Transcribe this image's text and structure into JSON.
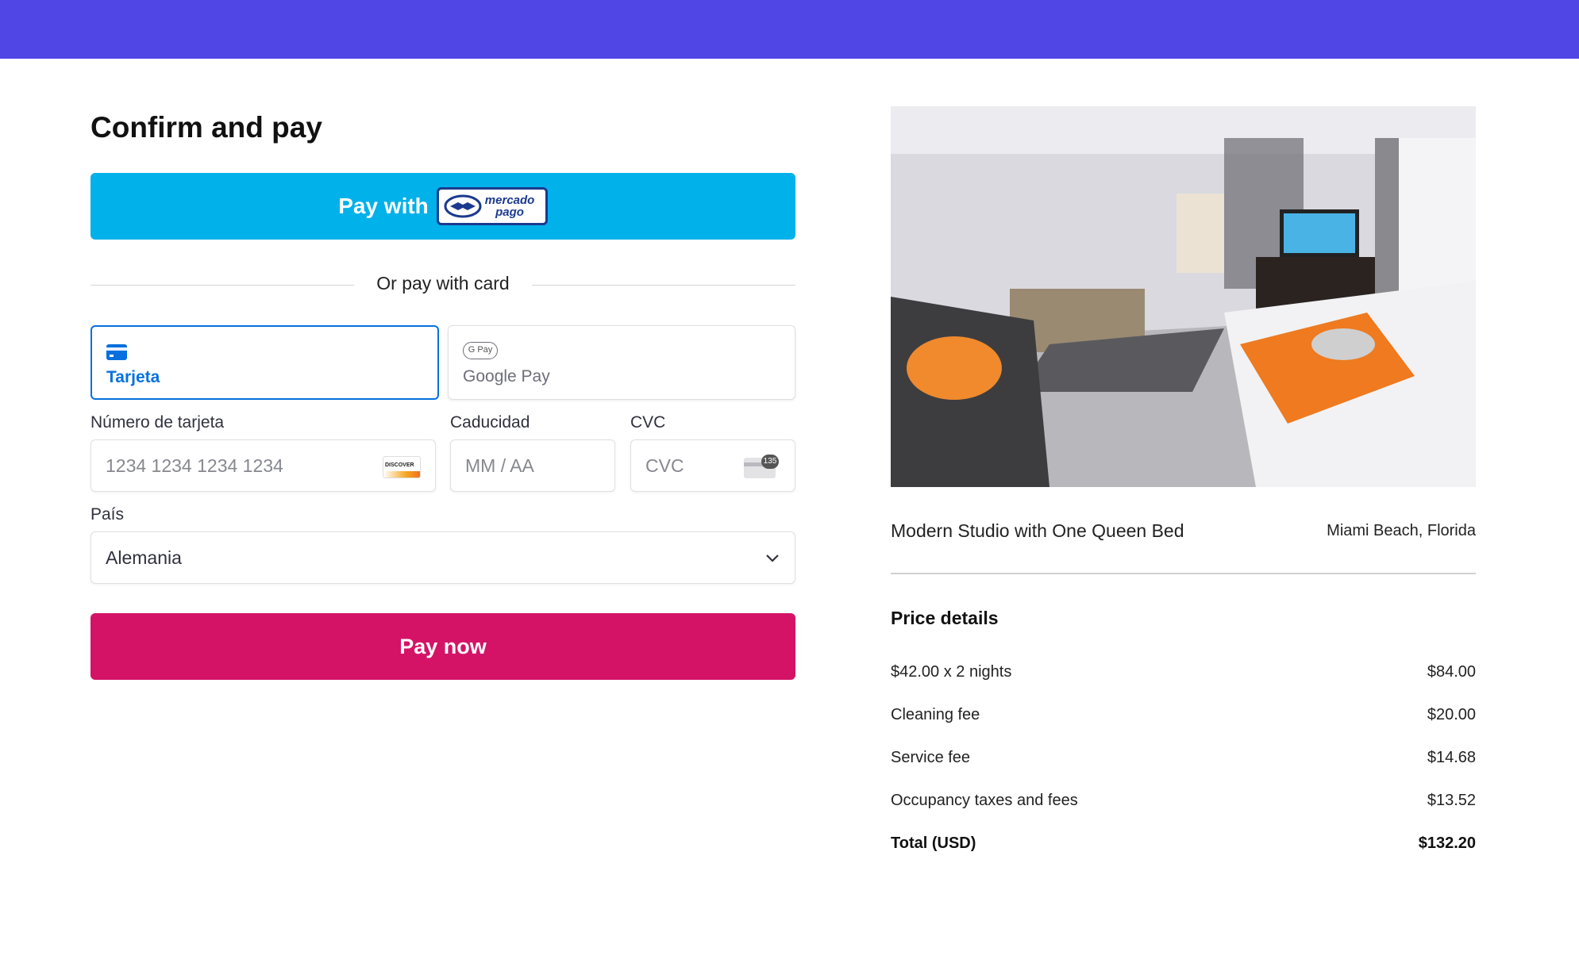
{
  "checkout": {
    "title": "Confirm and pay",
    "mercado_pago": {
      "label": "Pay with",
      "logo_text_line1": "mercado",
      "logo_text_line2": "pago"
    },
    "divider_text": "Or pay with card",
    "tabs": [
      {
        "label": "Tarjeta",
        "icon": "credit-card-icon",
        "selected": true
      },
      {
        "label": "Google Pay",
        "icon": "google-pay-icon",
        "badge": "G Pay",
        "selected": false
      }
    ],
    "card_number": {
      "label": "Número de tarjeta",
      "placeholder": "1234 1234 1234 1234",
      "brand_icon": "discover-icon",
      "brand_text": "DISCOVER"
    },
    "expiry": {
      "label": "Caducidad",
      "placeholder": "MM / AA"
    },
    "cvc": {
      "label": "CVC",
      "placeholder": "CVC",
      "badge": "135"
    },
    "country": {
      "label": "País",
      "value": "Alemania"
    },
    "pay_now_label": "Pay now"
  },
  "listing": {
    "name": "Modern Studio with One Queen Bed",
    "location": "Miami Beach, Florida"
  },
  "price_details": {
    "title": "Price details",
    "rows": [
      {
        "label": "$42.00 x 2 nights",
        "value": "$84.00"
      },
      {
        "label": "Cleaning fee",
        "value": "$20.00"
      },
      {
        "label": "Service fee",
        "value": "$14.68"
      },
      {
        "label": "Occupancy taxes and fees",
        "value": "$13.52"
      }
    ],
    "total": {
      "label": "Total (USD)",
      "value": "$132.20"
    }
  },
  "colors": {
    "topbar": "#5046e5",
    "mercado_pago": "#00b1ea",
    "pay_now": "#d41367",
    "selected_tab": "#0570de"
  }
}
